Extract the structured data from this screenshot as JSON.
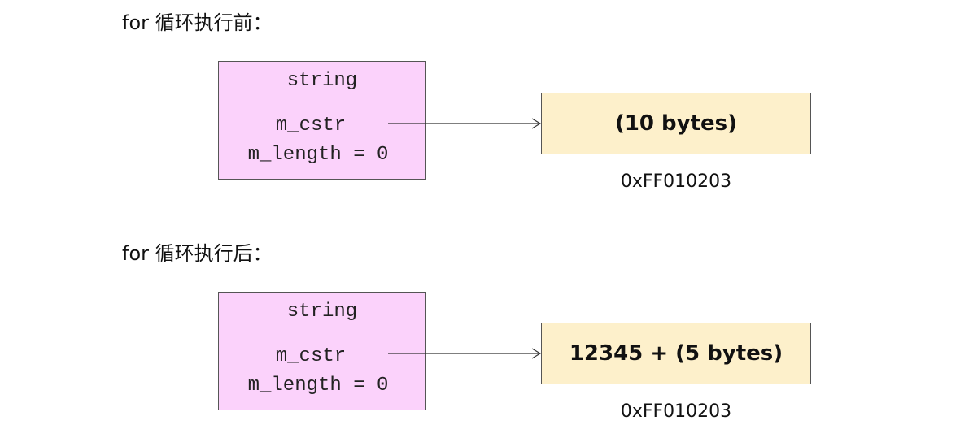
{
  "sections": [
    {
      "title": "for 循环执行前：",
      "object": {
        "type": "string",
        "field_ptr": "m_cstr",
        "field_len": "m_length = 0"
      },
      "memory": {
        "content": "(10 bytes)",
        "address": "0xFF010203"
      }
    },
    {
      "title": "for 循环执行后：",
      "object": {
        "type": "string",
        "field_ptr": "m_cstr",
        "field_len": "m_length = 0"
      },
      "memory": {
        "content": "12345 + (5 bytes)",
        "address": "0xFF010203"
      }
    }
  ],
  "colors": {
    "object_fill": "#fbd2fb",
    "memory_fill": "#fdf0cb",
    "border": "#555555",
    "arrow": "#333333"
  }
}
